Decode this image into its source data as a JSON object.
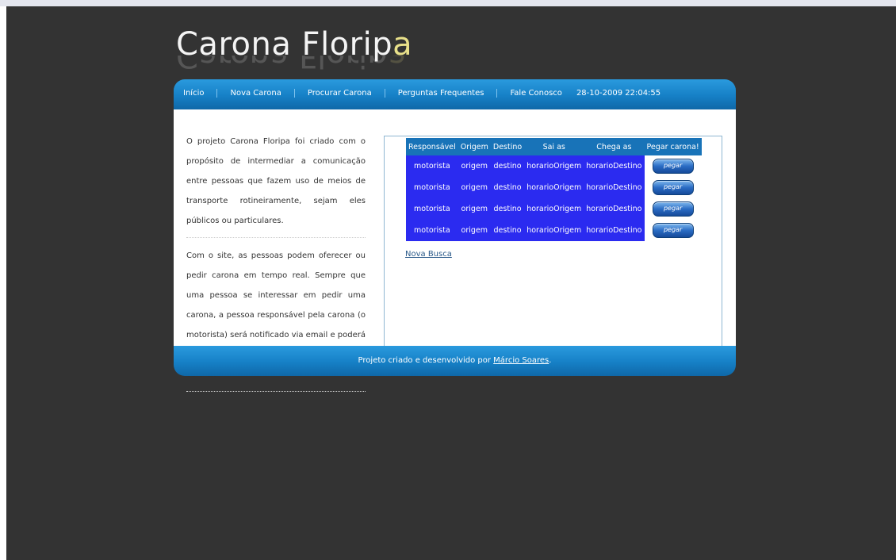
{
  "site": {
    "logo_main": "Carona Florip",
    "logo_accent": "a"
  },
  "nav": {
    "items": [
      {
        "label": "Início"
      },
      {
        "label": "Nova Carona"
      },
      {
        "label": "Procurar Carona"
      },
      {
        "label": "Perguntas Frequentes"
      },
      {
        "label": "Fale Conosco"
      }
    ],
    "datetime": "28-10-2009 22:04:55"
  },
  "intro": {
    "paragraph1": "O projeto Carona Floripa foi criado com o propósito de intermediar a comunicação entre pessoas que fazem uso de meios de transporte rotineiramente, sejam eles públicos ou particulares.",
    "paragraph2": "Com o site, as pessoas podem oferecer ou pedir carona em tempo real. Sempre que uma pessoa se interessar em pedir uma carona, a pessoa responsável pela carona (o motorista) será notificado via email e poderá entrar em contato com a pessoa que pediu a carona."
  },
  "results": {
    "headers": [
      "Responsável",
      "Origem",
      "Destino",
      "Sai as",
      "Chega as",
      "Pegar carona!"
    ],
    "rows": [
      {
        "responsavel": "motorista",
        "origem": "origem",
        "destino": "destino",
        "sai": "horarioOrigem",
        "chega": "horarioDestino",
        "action": "pegar"
      },
      {
        "responsavel": "motorista",
        "origem": "origem",
        "destino": "destino",
        "sai": "horarioOrigem",
        "chega": "horarioDestino",
        "action": "pegar"
      },
      {
        "responsavel": "motorista",
        "origem": "origem",
        "destino": "destino",
        "sai": "horarioOrigem",
        "chega": "horarioDestino",
        "action": "pegar"
      },
      {
        "responsavel": "motorista",
        "origem": "origem",
        "destino": "destino",
        "sai": "horarioOrigem",
        "chega": "horarioDestino",
        "action": "pegar"
      }
    ],
    "nova_busca": "Nova Busca"
  },
  "footer": {
    "text": "Projeto criado e desenvolvido por ",
    "author": "Márcio Soares",
    "period": "."
  },
  "colors": {
    "page_bg": "#333333",
    "bar_blue": "#1680c6",
    "table_blue": "#2b2bf0",
    "logo_accent": "#e8e08a"
  }
}
